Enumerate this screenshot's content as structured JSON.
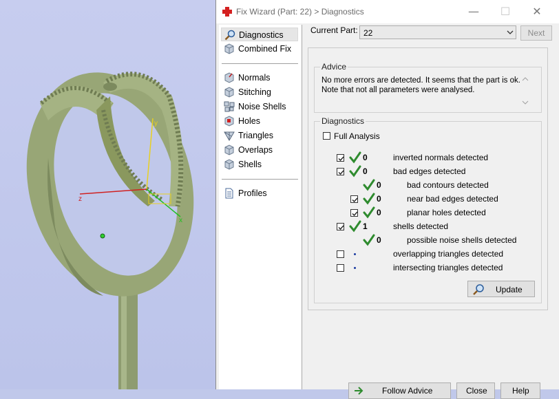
{
  "window": {
    "title": "Fix Wizard (Part: 22) > Diagnostics",
    "controls": [
      "minimize-icon",
      "maximize-icon",
      "close-icon"
    ]
  },
  "nav": {
    "top_items": [
      {
        "label": "Diagnostics",
        "icon": "magnifier-icon",
        "selected": true
      },
      {
        "label": "Combined Fix",
        "icon": "cube-icon"
      }
    ],
    "fix_items": [
      {
        "label": "Normals",
        "icon": "normals-icon"
      },
      {
        "label": "Stitching",
        "icon": "stitching-icon"
      },
      {
        "label": "Noise Shells",
        "icon": "noise-shells-icon"
      },
      {
        "label": "Holes",
        "icon": "holes-icon"
      },
      {
        "label": "Triangles",
        "icon": "triangles-icon"
      },
      {
        "label": "Overlaps",
        "icon": "overlaps-icon"
      },
      {
        "label": "Shells",
        "icon": "shells-icon"
      }
    ],
    "bottom_items": [
      {
        "label": "Profiles",
        "icon": "document-icon"
      }
    ]
  },
  "current_part": {
    "label": "Current Part:",
    "value": "22",
    "next_label": "Next"
  },
  "advice": {
    "title": "Advice",
    "text": "No more errors are detected. It seems that the part is ok.\nNote that not all parameters were analysed."
  },
  "diagnostics": {
    "title": "Diagnostics",
    "full_analysis_label": "Full Analysis",
    "full_analysis_checked": false,
    "rows": [
      {
        "checkbox": true,
        "checked": true,
        "status": "ok",
        "count": "0",
        "label": "inverted normals detected",
        "indent": 0
      },
      {
        "checkbox": true,
        "checked": true,
        "status": "ok",
        "count": "0",
        "label": "bad edges detected",
        "indent": 0
      },
      {
        "checkbox": false,
        "checked": false,
        "status": "ok",
        "count": "0",
        "label": "bad contours detected",
        "indent": 1
      },
      {
        "checkbox": true,
        "checked": true,
        "status": "ok",
        "count": "0",
        "label": "near bad edges detected",
        "indent": 1
      },
      {
        "checkbox": true,
        "checked": true,
        "status": "ok",
        "count": "0",
        "label": "planar holes detected",
        "indent": 1
      },
      {
        "checkbox": true,
        "checked": true,
        "status": "ok",
        "count": "1",
        "label": "shells detected",
        "indent": 0
      },
      {
        "checkbox": false,
        "checked": false,
        "status": "ok",
        "count": "0",
        "label": "possible noise shells detected",
        "indent": 1
      },
      {
        "checkbox": true,
        "checked": false,
        "status": "none",
        "count": "",
        "label": "overlapping triangles detected",
        "indent": 0
      },
      {
        "checkbox": true,
        "checked": false,
        "status": "none",
        "count": "",
        "label": "intersecting triangles detected",
        "indent": 0
      }
    ],
    "update_label": "Update"
  },
  "bottom_buttons": [
    {
      "label": "Follow Advice"
    },
    {
      "label": "Close"
    },
    {
      "label": "Help"
    }
  ],
  "viewport": {
    "axes": [
      "x",
      "y",
      "z"
    ],
    "model_color": "#9aa878",
    "background": "#c3caed"
  },
  "colors": {
    "ok_tick": "#2e8b2e",
    "app_icon": "#d42020",
    "dot": "#1a3aa0"
  }
}
